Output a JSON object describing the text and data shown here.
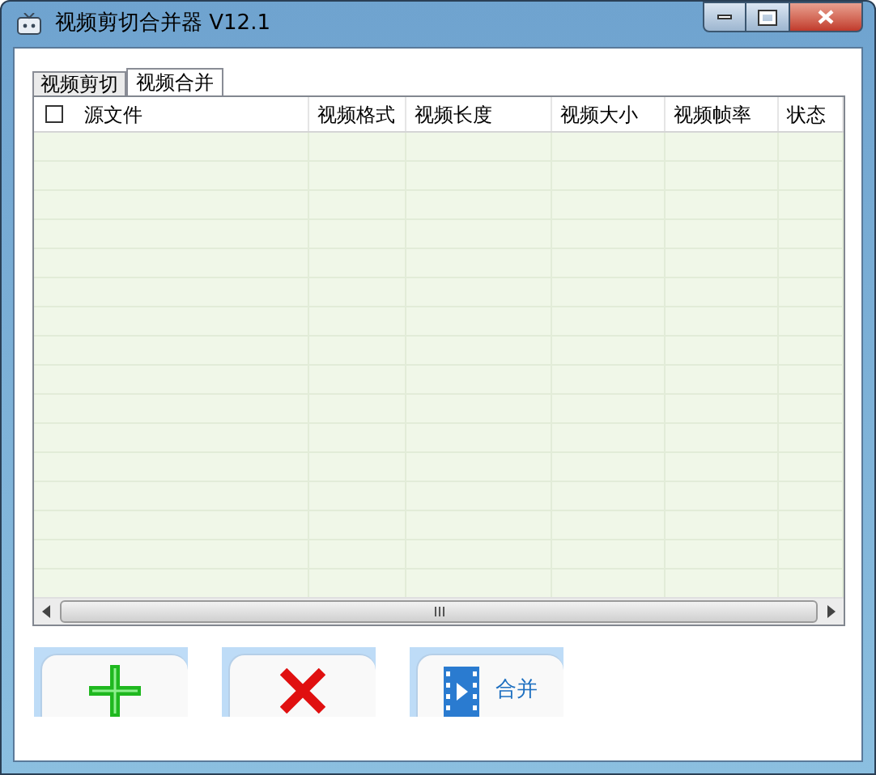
{
  "window": {
    "title": "视频剪切合并器 V12.1"
  },
  "tabs": [
    {
      "label": "视频剪切",
      "selected": false
    },
    {
      "label": "视频合并",
      "selected": true
    }
  ],
  "table": {
    "select_all": {
      "checked": false
    },
    "columns": [
      "源文件",
      "视频格式",
      "视频长度",
      "视频大小",
      "视频帧率",
      "状态"
    ]
  },
  "buttons": [
    {
      "kind": "add"
    },
    {
      "kind": "delete"
    },
    {
      "kind": "merge",
      "label": "合并"
    }
  ]
}
